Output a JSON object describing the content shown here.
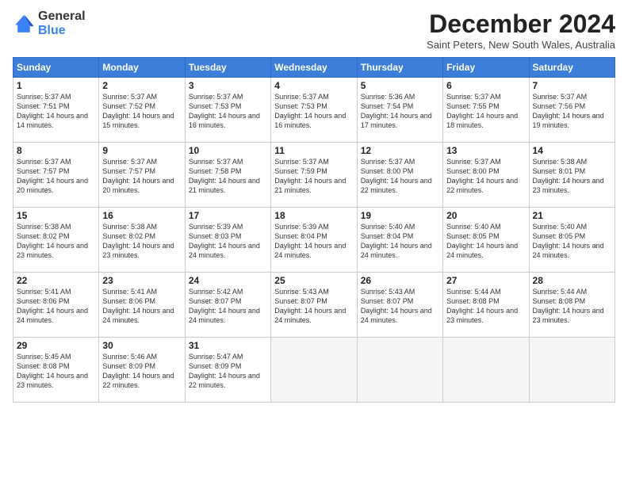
{
  "logo": {
    "general": "General",
    "blue": "Blue"
  },
  "title": "December 2024",
  "location": "Saint Peters, New South Wales, Australia",
  "headers": [
    "Sunday",
    "Monday",
    "Tuesday",
    "Wednesday",
    "Thursday",
    "Friday",
    "Saturday"
  ],
  "weeks": [
    [
      {
        "day": "1",
        "sunrise": "5:37 AM",
        "sunset": "7:51 PM",
        "daylight": "14 hours and 14 minutes."
      },
      {
        "day": "2",
        "sunrise": "5:37 AM",
        "sunset": "7:52 PM",
        "daylight": "14 hours and 15 minutes."
      },
      {
        "day": "3",
        "sunrise": "5:37 AM",
        "sunset": "7:53 PM",
        "daylight": "14 hours and 16 minutes."
      },
      {
        "day": "4",
        "sunrise": "5:37 AM",
        "sunset": "7:53 PM",
        "daylight": "14 hours and 16 minutes."
      },
      {
        "day": "5",
        "sunrise": "5:36 AM",
        "sunset": "7:54 PM",
        "daylight": "14 hours and 17 minutes."
      },
      {
        "day": "6",
        "sunrise": "5:37 AM",
        "sunset": "7:55 PM",
        "daylight": "14 hours and 18 minutes."
      },
      {
        "day": "7",
        "sunrise": "5:37 AM",
        "sunset": "7:56 PM",
        "daylight": "14 hours and 19 minutes."
      }
    ],
    [
      {
        "day": "8",
        "sunrise": "5:37 AM",
        "sunset": "7:57 PM",
        "daylight": "14 hours and 20 minutes."
      },
      {
        "day": "9",
        "sunrise": "5:37 AM",
        "sunset": "7:57 PM",
        "daylight": "14 hours and 20 minutes."
      },
      {
        "day": "10",
        "sunrise": "5:37 AM",
        "sunset": "7:58 PM",
        "daylight": "14 hours and 21 minutes."
      },
      {
        "day": "11",
        "sunrise": "5:37 AM",
        "sunset": "7:59 PM",
        "daylight": "14 hours and 21 minutes."
      },
      {
        "day": "12",
        "sunrise": "5:37 AM",
        "sunset": "8:00 PM",
        "daylight": "14 hours and 22 minutes."
      },
      {
        "day": "13",
        "sunrise": "5:37 AM",
        "sunset": "8:00 PM",
        "daylight": "14 hours and 22 minutes."
      },
      {
        "day": "14",
        "sunrise": "5:38 AM",
        "sunset": "8:01 PM",
        "daylight": "14 hours and 23 minutes."
      }
    ],
    [
      {
        "day": "15",
        "sunrise": "5:38 AM",
        "sunset": "8:02 PM",
        "daylight": "14 hours and 23 minutes."
      },
      {
        "day": "16",
        "sunrise": "5:38 AM",
        "sunset": "8:02 PM",
        "daylight": "14 hours and 23 minutes."
      },
      {
        "day": "17",
        "sunrise": "5:39 AM",
        "sunset": "8:03 PM",
        "daylight": "14 hours and 24 minutes."
      },
      {
        "day": "18",
        "sunrise": "5:39 AM",
        "sunset": "8:04 PM",
        "daylight": "14 hours and 24 minutes."
      },
      {
        "day": "19",
        "sunrise": "5:40 AM",
        "sunset": "8:04 PM",
        "daylight": "14 hours and 24 minutes."
      },
      {
        "day": "20",
        "sunrise": "5:40 AM",
        "sunset": "8:05 PM",
        "daylight": "14 hours and 24 minutes."
      },
      {
        "day": "21",
        "sunrise": "5:40 AM",
        "sunset": "8:05 PM",
        "daylight": "14 hours and 24 minutes."
      }
    ],
    [
      {
        "day": "22",
        "sunrise": "5:41 AM",
        "sunset": "8:06 PM",
        "daylight": "14 hours and 24 minutes."
      },
      {
        "day": "23",
        "sunrise": "5:41 AM",
        "sunset": "8:06 PM",
        "daylight": "14 hours and 24 minutes."
      },
      {
        "day": "24",
        "sunrise": "5:42 AM",
        "sunset": "8:07 PM",
        "daylight": "14 hours and 24 minutes."
      },
      {
        "day": "25",
        "sunrise": "5:43 AM",
        "sunset": "8:07 PM",
        "daylight": "14 hours and 24 minutes."
      },
      {
        "day": "26",
        "sunrise": "5:43 AM",
        "sunset": "8:07 PM",
        "daylight": "14 hours and 24 minutes."
      },
      {
        "day": "27",
        "sunrise": "5:44 AM",
        "sunset": "8:08 PM",
        "daylight": "14 hours and 23 minutes."
      },
      {
        "day": "28",
        "sunrise": "5:44 AM",
        "sunset": "8:08 PM",
        "daylight": "14 hours and 23 minutes."
      }
    ],
    [
      {
        "day": "29",
        "sunrise": "5:45 AM",
        "sunset": "8:08 PM",
        "daylight": "14 hours and 23 minutes."
      },
      {
        "day": "30",
        "sunrise": "5:46 AM",
        "sunset": "8:09 PM",
        "daylight": "14 hours and 22 minutes."
      },
      {
        "day": "31",
        "sunrise": "5:47 AM",
        "sunset": "8:09 PM",
        "daylight": "14 hours and 22 minutes."
      },
      null,
      null,
      null,
      null
    ]
  ]
}
